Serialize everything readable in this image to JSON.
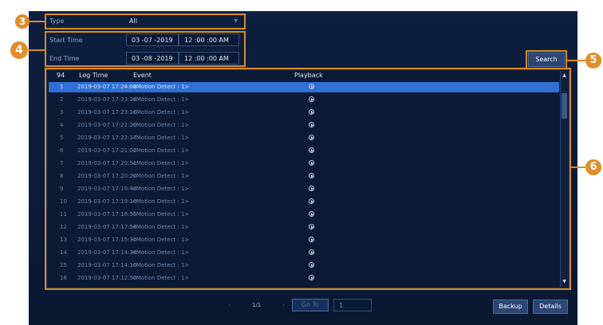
{
  "filters": {
    "type_label": "Type",
    "type_value": "All",
    "start_label": "Start Time",
    "start_date": "03 -07 -2019",
    "start_time": "12 :00 :00 AM",
    "end_label": "End Time",
    "end_date": "03 -08 -2019",
    "end_time": "12 :00 :00 AM",
    "search_label": "Search"
  },
  "callouts": [
    "3",
    "4",
    "5",
    "6"
  ],
  "table": {
    "headers": {
      "count": "94",
      "log_time": "Log Time",
      "event": "Event",
      "playback": "Playback"
    },
    "rows": [
      {
        "num": "1",
        "time": "2019-03-07 17:24:03",
        "event": "<Motion Detect : 1>"
      },
      {
        "num": "2",
        "time": "2019-03-07 17:23:28",
        "event": "<Motion Detect : 1>"
      },
      {
        "num": "3",
        "time": "2019-03-07 17:23:16",
        "event": "<Motion Detect : 1>"
      },
      {
        "num": "4",
        "time": "2019-03-07 17:22:20",
        "event": "<Motion Detect : 1>"
      },
      {
        "num": "5",
        "time": "2019-03-07 17:22:17",
        "event": "<Motion Detect : 1>"
      },
      {
        "num": "6",
        "time": "2019-03-07 17:21:02",
        "event": "<Motion Detect : 1>"
      },
      {
        "num": "7",
        "time": "2019-03-07 17:20:51",
        "event": "<Motion Detect : 1>"
      },
      {
        "num": "8",
        "time": "2019-03-07 17:20:20",
        "event": "<Motion Detect : 1>"
      },
      {
        "num": "9",
        "time": "2019-03-07 17:19:43",
        "event": "<Motion Detect : 1>"
      },
      {
        "num": "10",
        "time": "2019-03-07 17:19:10",
        "event": "<Motion Detect : 1>"
      },
      {
        "num": "11",
        "time": "2019-03-07 17:18:55",
        "event": "<Motion Detect : 1>"
      },
      {
        "num": "12",
        "time": "2019-03-07 17:17:58",
        "event": "<Motion Detect : 1>"
      },
      {
        "num": "13",
        "time": "2019-03-07 17:15:35",
        "event": "<Motion Detect : 1>"
      },
      {
        "num": "14",
        "time": "2019-03-07 17:14:38",
        "event": "<Motion Detect : 1>"
      },
      {
        "num": "15",
        "time": "2019-03-07 17:14:10",
        "event": "<Motion Detect : 1>"
      },
      {
        "num": "16",
        "time": "2019-03-07 17:12:50",
        "event": "<Motion Detect : 1>"
      }
    ]
  },
  "pager": {
    "page": "1/1",
    "goto_label": "Go To",
    "goto_value": "1"
  },
  "buttons": {
    "backup": "Backup",
    "details": "Details"
  },
  "colors": {
    "accent": "#e38d28",
    "selected_row": "#2f6fd6",
    "background": "#0f1f3f"
  }
}
